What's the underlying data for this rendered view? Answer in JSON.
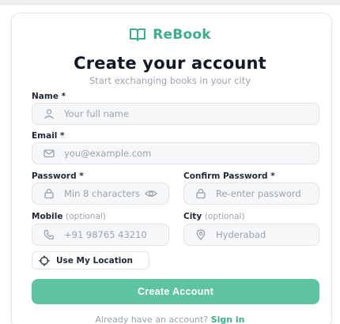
{
  "brand": {
    "name": "ReBook",
    "icon": "open-book-icon",
    "color": "#3dae8d"
  },
  "header": {
    "title": "Create your account",
    "subtitle": "Start exchanging books in your city"
  },
  "form": {
    "name": {
      "label": "Name *",
      "placeholder": "Your full name",
      "icon": "user-icon"
    },
    "email": {
      "label": "Email *",
      "placeholder": "you@example.com",
      "icon": "mail-icon"
    },
    "password": {
      "label": "Password *",
      "placeholder": "Min 8 characters",
      "icon": "lock-icon",
      "toggle_icon": "eye-icon"
    },
    "confirm_password": {
      "label": "Confirm Password *",
      "placeholder": "Re-enter password",
      "icon": "lock-icon"
    },
    "mobile": {
      "label": "Mobile",
      "optional": "(optional)",
      "placeholder": "+91 98765 43210",
      "icon": "phone-icon"
    },
    "city": {
      "label": "City",
      "optional": "(optional)",
      "placeholder": "Hyderabad",
      "icon": "map-pin-icon"
    },
    "location_button": {
      "label": "Use My Location",
      "icon": "crosshair-icon"
    },
    "submit": {
      "label": "Create Account",
      "color": "#5dc49f"
    }
  },
  "footer": {
    "text": "Already have an account?",
    "link": "Sign in"
  }
}
